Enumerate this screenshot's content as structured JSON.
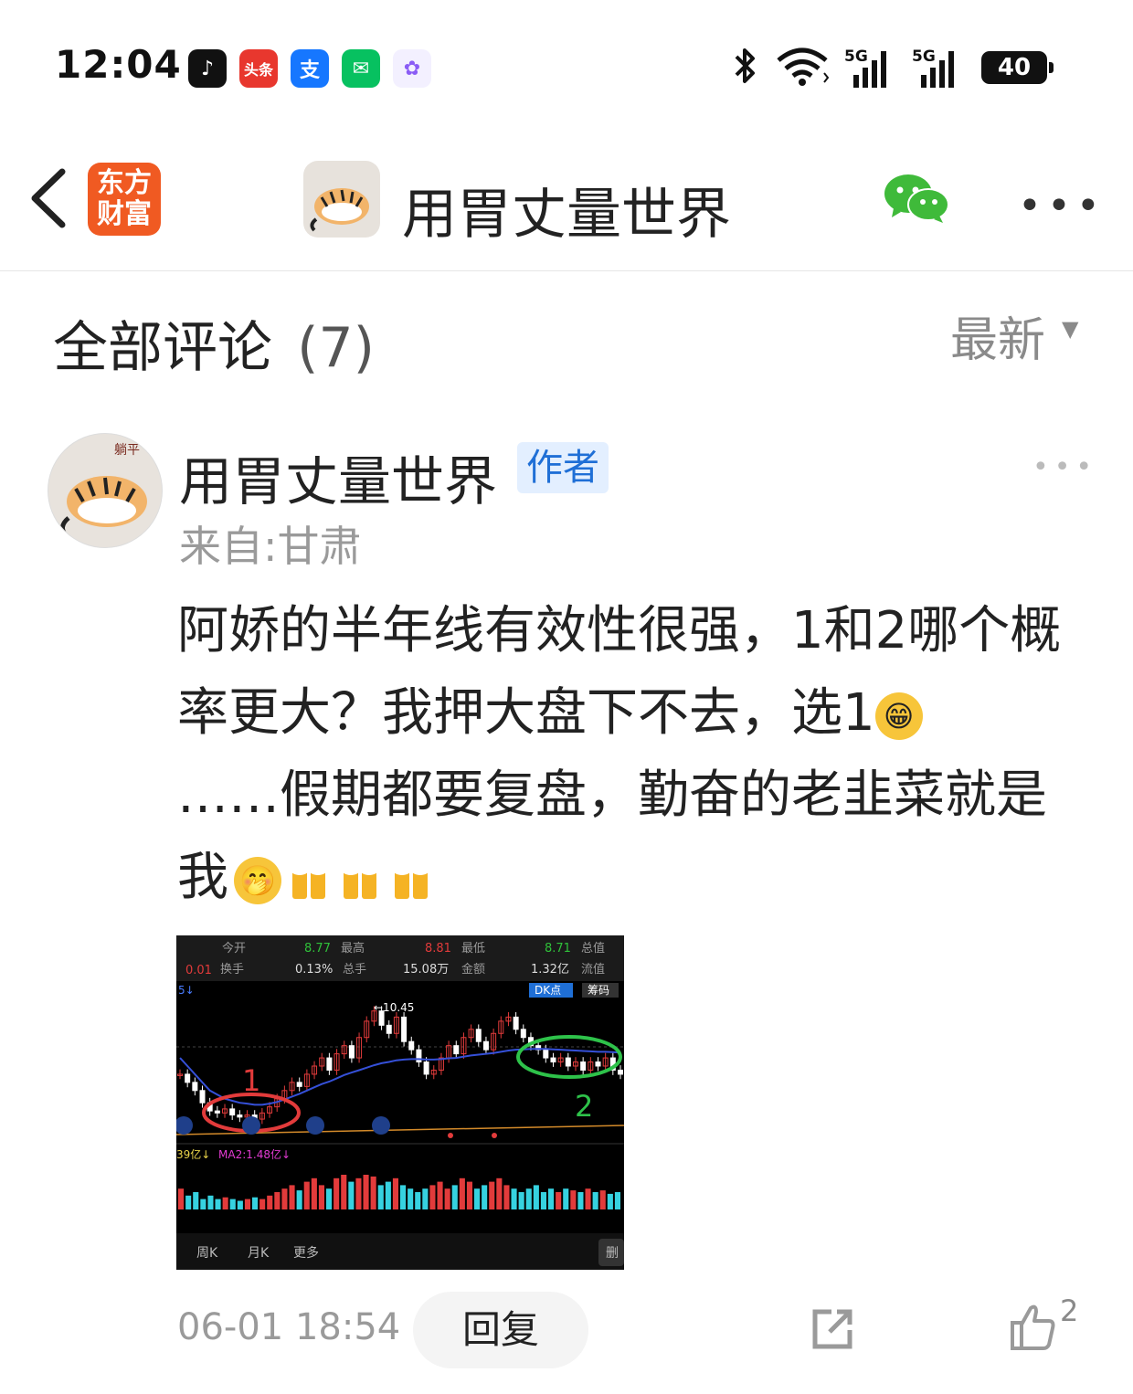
{
  "status_bar": {
    "time": "12:04",
    "apps": [
      {
        "name": "tiktok-icon",
        "glyph": "♪",
        "color": "#111111"
      },
      {
        "name": "toutiao-icon",
        "glyph": "头条",
        "color": "#e8372e"
      },
      {
        "name": "alipay-icon",
        "glyph": "支",
        "color": "#1677ff"
      },
      {
        "name": "wechat-icon",
        "glyph": "✉",
        "color": "#07c160"
      },
      {
        "name": "multicolor-app-icon",
        "glyph": "✿",
        "color": "#f3f0ff"
      }
    ],
    "signal_1": "5G",
    "signal_2": "5G",
    "battery": "40"
  },
  "header": {
    "brand_line1": "东方",
    "brand_line2": "财富",
    "title": "用胃丈量世界"
  },
  "comments": {
    "label": "全部评论",
    "count": "(7)",
    "sort": "最新"
  },
  "comment": {
    "author": "用胃丈量世界",
    "badge": "作者",
    "location": "来自:甘肃",
    "text_1": "阿娇的半年线有效性很强，1和2哪个概率更大？我押大盘下不去，选1",
    "text_2": "……假期都要复盘，勤奋的老韭菜就是我",
    "date": "06-01 18:54",
    "reply": "回复",
    "likes": "2"
  },
  "chart_image": {
    "stats": {
      "label_open": "今开",
      "open": "8.77",
      "label_high": "最高",
      "high": "8.81",
      "label_low": "最低",
      "low": "8.71",
      "label_total": "总值",
      "change": "0.01",
      "label_turnover": "换手",
      "turnover": "0.13%",
      "label_volume": "总手",
      "volume": "15.08万",
      "label_amount": "金额",
      "amount": "1.32亿",
      "label_float": "流值"
    },
    "tag_dk": "DK点",
    "tag_chip": "筹码",
    "axis_marker": "5↓",
    "peak_label": "←10.45",
    "mark_1": "1",
    "mark_2": "2",
    "ma_left": "39亿↓",
    "ma2": "MA2:1.48亿↓",
    "tabs": [
      "周K",
      "月K",
      "更多"
    ],
    "corner": "删",
    "prices": [
      8.9,
      8.7,
      8.5,
      8.2,
      8.0,
      7.95,
      8.05,
      7.9,
      7.85,
      7.9,
      7.8,
      7.95,
      8.1,
      8.3,
      8.5,
      8.7,
      8.6,
      8.9,
      9.1,
      9.3,
      9.0,
      9.4,
      9.6,
      9.3,
      9.8,
      10.2,
      10.45,
      10.1,
      9.9,
      10.3,
      9.7,
      9.5,
      9.2,
      8.9,
      9.0,
      9.3,
      9.6,
      9.4,
      9.8,
      10.0,
      9.7,
      9.5,
      9.9,
      10.2,
      10.3,
      10.0,
      9.8,
      9.6,
      9.5,
      9.3,
      9.2,
      9.3,
      9.1,
      9.2,
      9.0,
      9.2,
      9.1,
      9.3,
      9.0,
      8.9
    ],
    "ma": [
      9.3,
      9.1,
      8.9,
      8.7,
      8.5,
      8.4,
      8.3,
      8.25,
      8.2,
      8.18,
      8.15,
      8.15,
      8.18,
      8.22,
      8.28,
      8.35,
      8.42,
      8.5,
      8.58,
      8.66,
      8.72,
      8.8,
      8.88,
      8.94,
      9.0,
      9.06,
      9.12,
      9.17,
      9.2,
      9.24,
      9.26,
      9.27,
      9.27,
      9.26,
      9.26,
      9.27,
      9.29,
      9.3,
      9.33,
      9.36,
      9.38,
      9.4,
      9.42,
      9.45,
      9.48,
      9.5,
      9.51,
      9.52,
      9.52,
      9.52,
      9.51,
      9.5,
      9.49,
      9.48,
      9.47,
      9.46,
      9.45,
      9.45,
      9.44,
      9.43
    ],
    "volumes": [
      0.6,
      0.4,
      0.5,
      0.3,
      0.4,
      0.3,
      0.35,
      0.3,
      0.25,
      0.3,
      0.35,
      0.3,
      0.4,
      0.5,
      0.6,
      0.7,
      0.55,
      0.8,
      0.9,
      0.7,
      0.6,
      0.9,
      1.0,
      0.8,
      0.9,
      1.0,
      0.95,
      0.7,
      0.8,
      0.9,
      0.7,
      0.6,
      0.5,
      0.6,
      0.7,
      0.8,
      0.6,
      0.7,
      0.9,
      0.8,
      0.6,
      0.7,
      0.8,
      0.9,
      0.7,
      0.6,
      0.5,
      0.6,
      0.7,
      0.5,
      0.6,
      0.5,
      0.6,
      0.55,
      0.5,
      0.6,
      0.5,
      0.55,
      0.45,
      0.5
    ]
  }
}
